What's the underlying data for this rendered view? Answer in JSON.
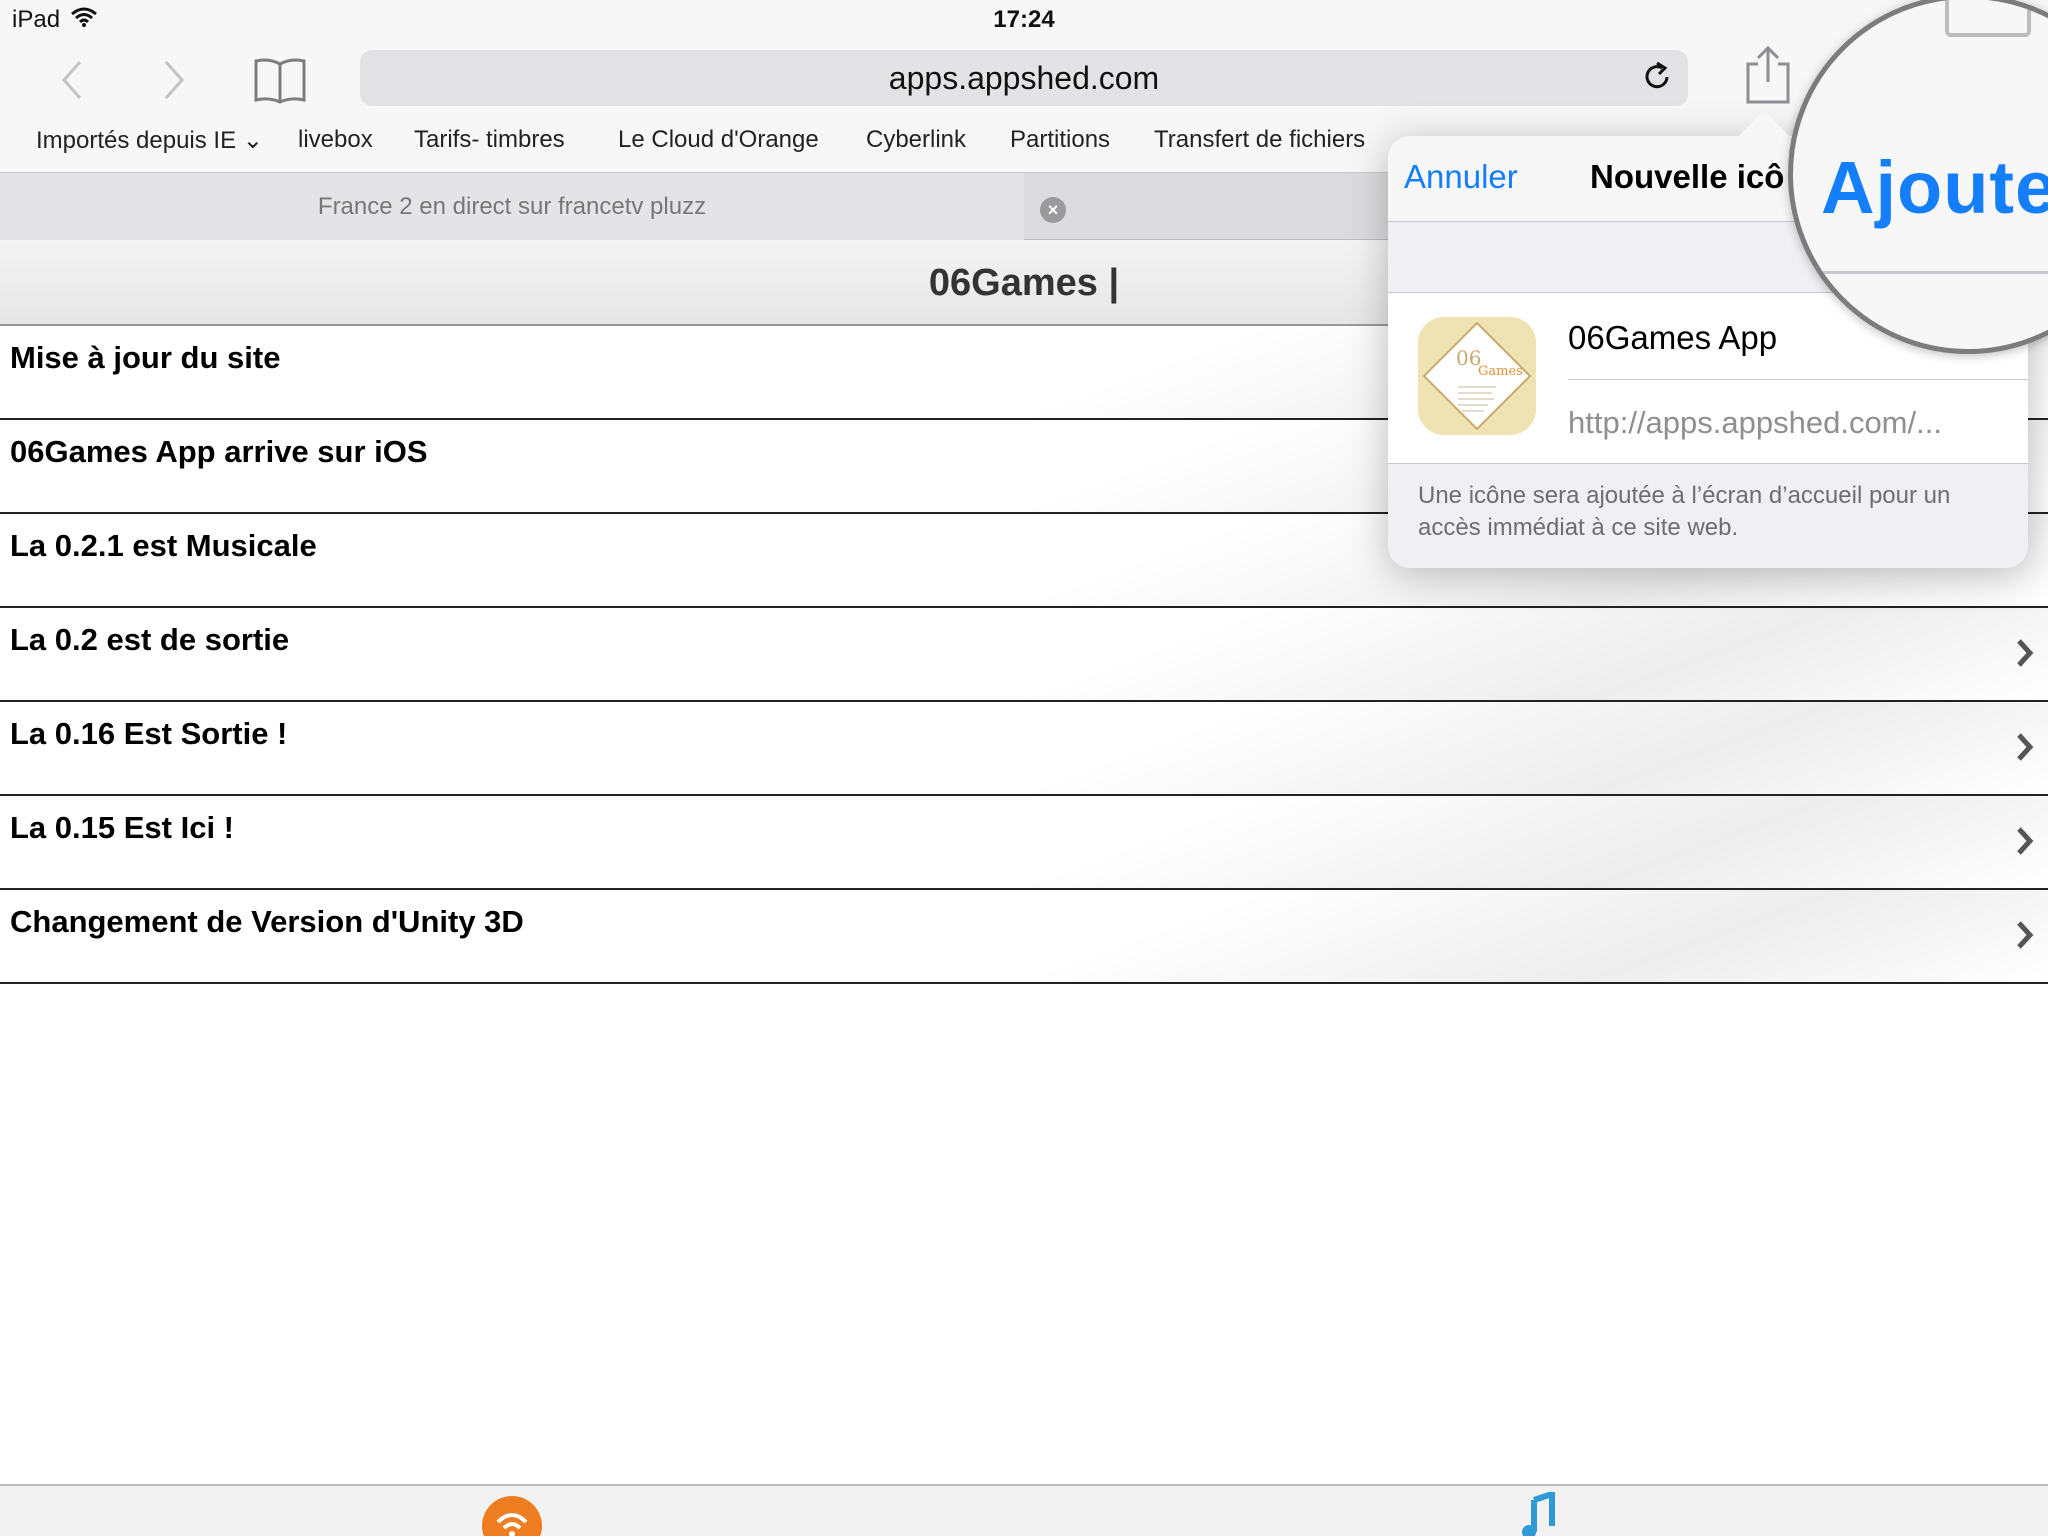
{
  "status_bar": {
    "carrier": "iPad",
    "time": "17:24"
  },
  "toolbar": {
    "url": "apps.appshed.com",
    "icons": [
      "back-icon",
      "forward-icon",
      "bookmarks-icon",
      "reload-icon",
      "share-icon"
    ]
  },
  "bookmarks": [
    "Importés depuis IE",
    "livebox",
    "Tarifs- timbres",
    "Le Cloud d'Orange",
    "Cyberlink",
    "Partitions",
    "Transfert de fichiers"
  ],
  "tab": {
    "title": "France 2 en direct sur francetv pluzz",
    "close_symbol": "×"
  },
  "page": {
    "title": "06Games |",
    "items": [
      "Mise à jour du site",
      "06Games App arrive sur iOS",
      "La 0.2.1 est Musicale",
      "La 0.2 est de sortie",
      "La 0.16 Est Sortie !",
      "La 0.15 Est Ici !",
      "Changement de Version d'Unity 3D"
    ]
  },
  "popover": {
    "cancel_label": "Annuler",
    "title": "Nouvelle icô",
    "add_label": "Ajouter",
    "app_name": "06Games App",
    "app_url": "http://apps.appshed.com/...",
    "footer": "Une icône sera ajoutée à l’écran d’accueil pour un accès immédiat à ce site web.",
    "accent_color": "#157efb"
  },
  "bottom_bar": {
    "icons": [
      "rss-icon",
      "music-icon"
    ],
    "rss_color": "#ef7d22"
  }
}
